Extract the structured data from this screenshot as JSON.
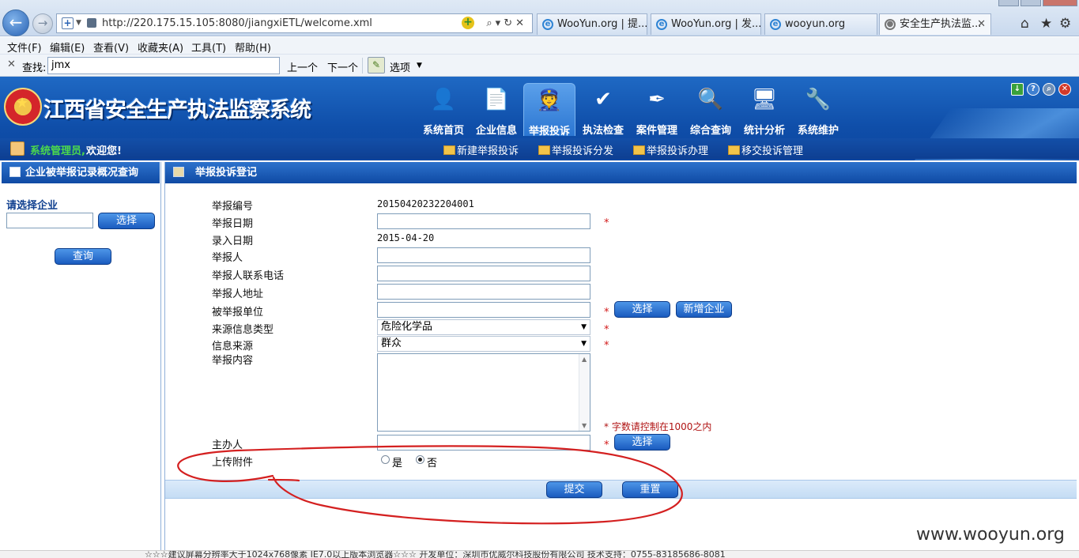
{
  "browser": {
    "url": "http://220.175.15.105:8080/jiangxiETL/welcome.xml",
    "tabs": [
      {
        "label": "WooYun.org | 提..."
      },
      {
        "label": "WooYun.org | 发..."
      },
      {
        "label": "wooyun.org"
      },
      {
        "label": "安全生产执法监...",
        "active": true
      }
    ],
    "menu": [
      "文件(F)",
      "编辑(E)",
      "查看(V)",
      "收藏夹(A)",
      "工具(T)",
      "帮助(H)"
    ],
    "find": {
      "label": "查找:",
      "value": "jmx",
      "prev": "上一个",
      "next": "下一个",
      "options": "选项"
    }
  },
  "header": {
    "title": "江西省安全生产执法监察系统",
    "nav": [
      {
        "label": "系统首页",
        "icon": "person-icon"
      },
      {
        "label": "企业信息",
        "icon": "document-icon"
      },
      {
        "label": "举报投诉",
        "icon": "officer-icon",
        "active": true
      },
      {
        "label": "执法检查",
        "icon": "checklist-icon"
      },
      {
        "label": "案件管理",
        "icon": "pen-icon"
      },
      {
        "label": "综合查询",
        "icon": "magnifier-icon"
      },
      {
        "label": "统计分析",
        "icon": "monitor-icon"
      },
      {
        "label": "系统维护",
        "icon": "tools-icon"
      }
    ],
    "user_role": "系统管理员,",
    "welcome": "欢迎您!",
    "subnav": [
      "新建举报投诉",
      "举报投诉分发",
      "举报投诉办理",
      "移交投诉管理"
    ]
  },
  "left_panel": {
    "title": "企业被举报记录概况查询",
    "select_label": "请选择企业",
    "select_button": "选择",
    "query_button": "查询"
  },
  "form": {
    "title": "举报投诉登记",
    "fields": {
      "report_no_label": "举报编号",
      "report_no_value": "20150420232204001",
      "report_date_label": "举报日期",
      "entry_date_label": "录入日期",
      "entry_date_value": "2015-04-20",
      "reporter_label": "举报人",
      "reporter_phone_label": "举报人联系电话",
      "reporter_address_label": "举报人地址",
      "reported_unit_label": "被举报单位",
      "source_type_label": "来源信息类型",
      "source_type_value": "危险化学品",
      "info_source_label": "信息来源",
      "info_source_value": "群众",
      "content_label": "举报内容",
      "handler_label": "主办人",
      "upload_label": "上传附件"
    },
    "required_mark": "*",
    "content_hint": "字数请控制在1000之内",
    "select_button": "选择",
    "add_company_button": "新增企业",
    "radio_yes": "是",
    "radio_no": "否",
    "upload_selected": "否",
    "submit_button": "提交",
    "reset_button": "重置"
  },
  "footer_text": "☆☆☆建议屏幕分辨率大于1024x768像素 IE7.0以上版本浏览器☆☆☆ 开发单位：深圳市优威尔科技股份有限公司 技术支持：0755-83185686-8081",
  "watermark": "www.wooyun.org",
  "colors": {
    "header_blue": "#0f4ea9",
    "required_red": "#d21a1a",
    "role_green": "#4cd94c",
    "annotation_red": "#d42020"
  }
}
